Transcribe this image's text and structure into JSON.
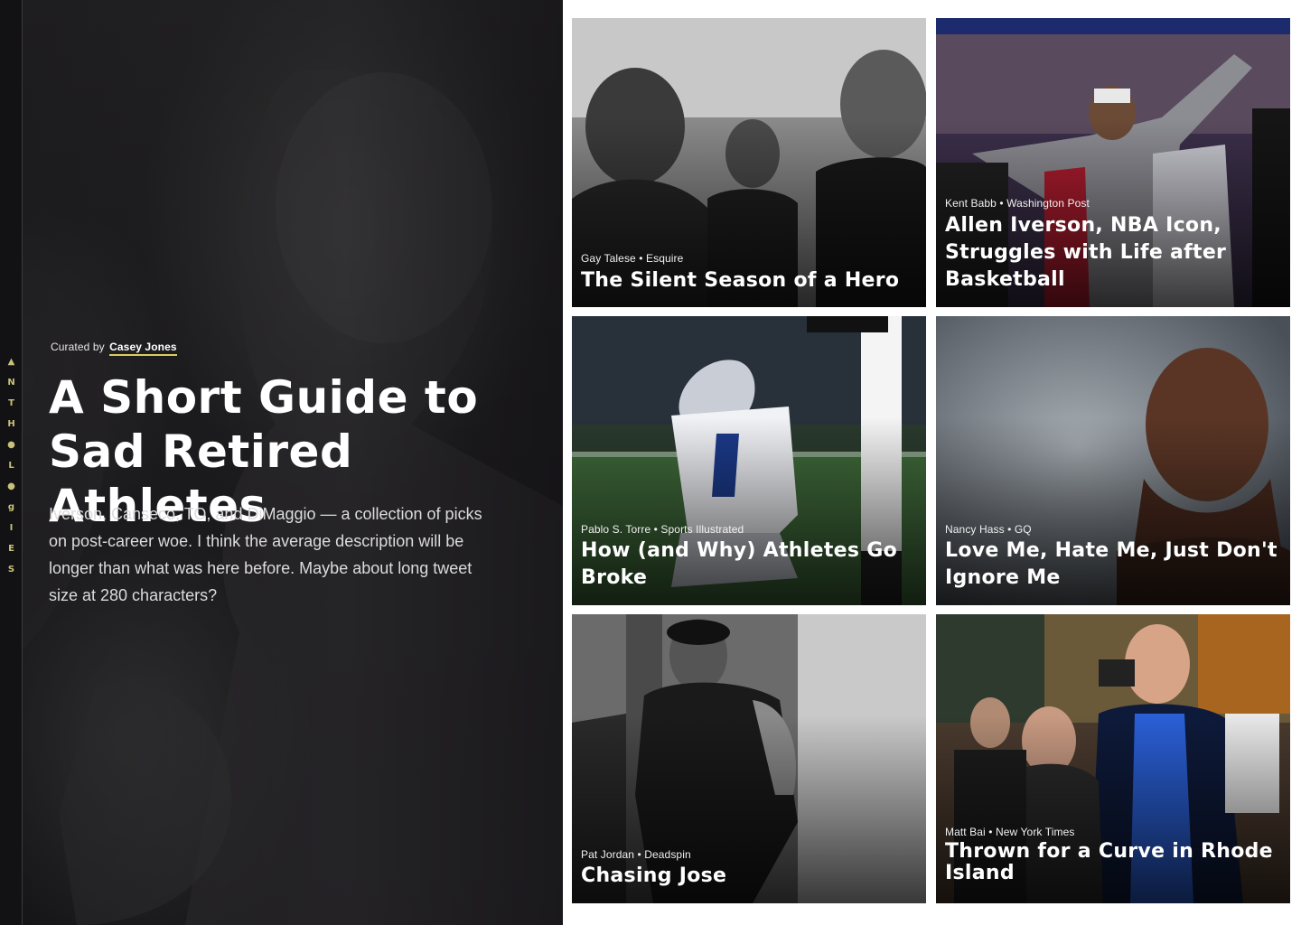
{
  "rail": {
    "letters": [
      "▲",
      "N",
      "T",
      "H",
      "●",
      "L",
      "●",
      "g",
      "I",
      "E",
      "S"
    ]
  },
  "hero": {
    "curated_prefix": "Curated by",
    "curator": "Casey Jones",
    "title": "A Short Guide to Sad Retired Athletes",
    "description": "Iverson, Canseco, TO, and DiMaggio — a collection of picks on post-career woe. I think the average description will be longer than what was here before. Maybe about long tweet size at 280 characters?"
  },
  "cards": [
    {
      "author": "Gay Talese",
      "publication": "Esquire",
      "title": "The Silent Season of a Hero"
    },
    {
      "author": "Kent Babb",
      "publication": "Washington Post",
      "title": "Allen Iverson, NBA Icon, Struggles with Life after Basketball"
    },
    {
      "author": "Pablo S. Torre",
      "publication": "Sports Illustrated",
      "title": "How (and Why) Athletes Go Broke"
    },
    {
      "author": "Nancy Hass",
      "publication": "GQ",
      "title": "Love Me, Hate Me, Just Don't Ignore Me"
    },
    {
      "author": "Pat Jordan",
      "publication": "Deadspin",
      "title": "Chasing Jose"
    },
    {
      "author": "Matt Bai",
      "publication": "New York Times",
      "title": "Thrown for a Curve in Rhode Island"
    }
  ],
  "separator": "•",
  "colors": {
    "rail_background": "#121114",
    "rail_letter": "#c9c07a",
    "curator_underline": "#d8cf5a",
    "hero_background": "#1d1c1f"
  }
}
